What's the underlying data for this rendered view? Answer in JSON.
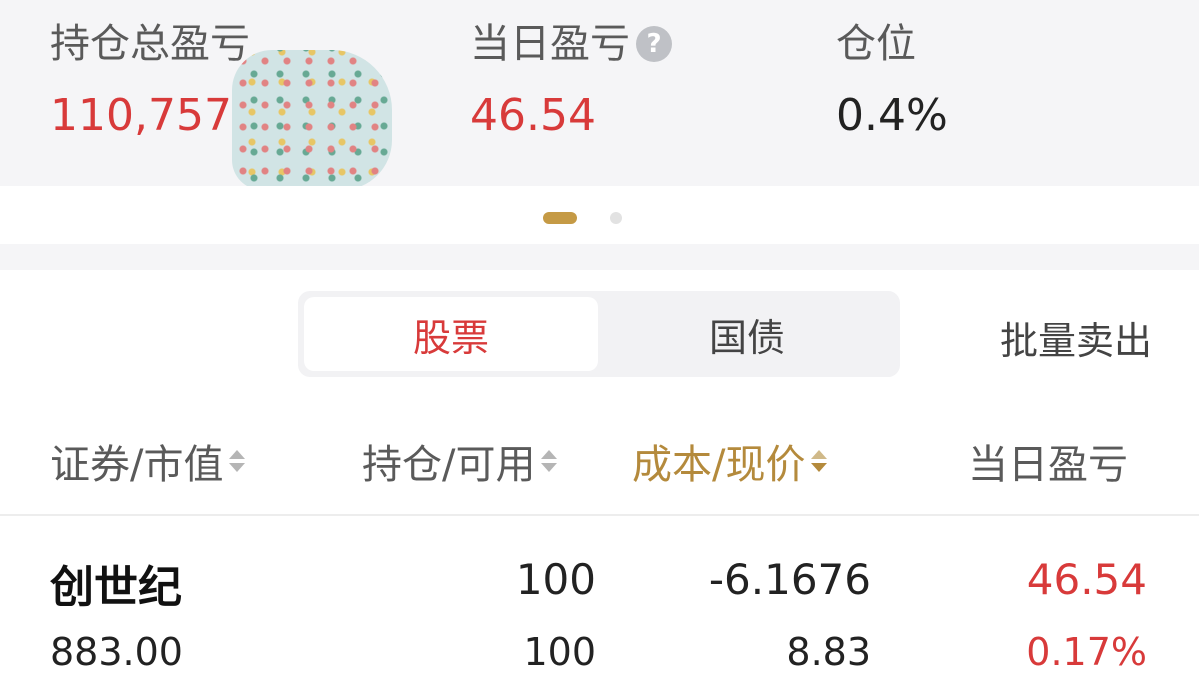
{
  "summary": {
    "total_pnl_label": "持仓总盈亏",
    "total_pnl_value": "110,757",
    "daily_pnl_label": "当日盈亏",
    "daily_pnl_help": "?",
    "daily_pnl_value": "46.54",
    "position_label": "仓位",
    "position_value": "0.4%"
  },
  "pager": {
    "pages": 2,
    "active": 1
  },
  "segment": {
    "tabs": [
      {
        "label": "股票",
        "active": true
      },
      {
        "label": "国债",
        "active": false
      }
    ]
  },
  "batch_sell_label": "批量卖出",
  "columns": {
    "security": "证券/市值",
    "holding": "持仓/可用",
    "cost": "成本/现价",
    "daily_pnl": "当日盈亏"
  },
  "rows": [
    {
      "name": "创世纪",
      "market_value": "883.00",
      "holding": "100",
      "available": "100",
      "cost": "-6.1676",
      "price": "8.83",
      "daily_pnl": "46.54",
      "daily_pnl_pct": "0.17%"
    }
  ],
  "colors": {
    "up": "#d83a3a",
    "accent": "#c59a45",
    "background": "#f5f5f7"
  }
}
